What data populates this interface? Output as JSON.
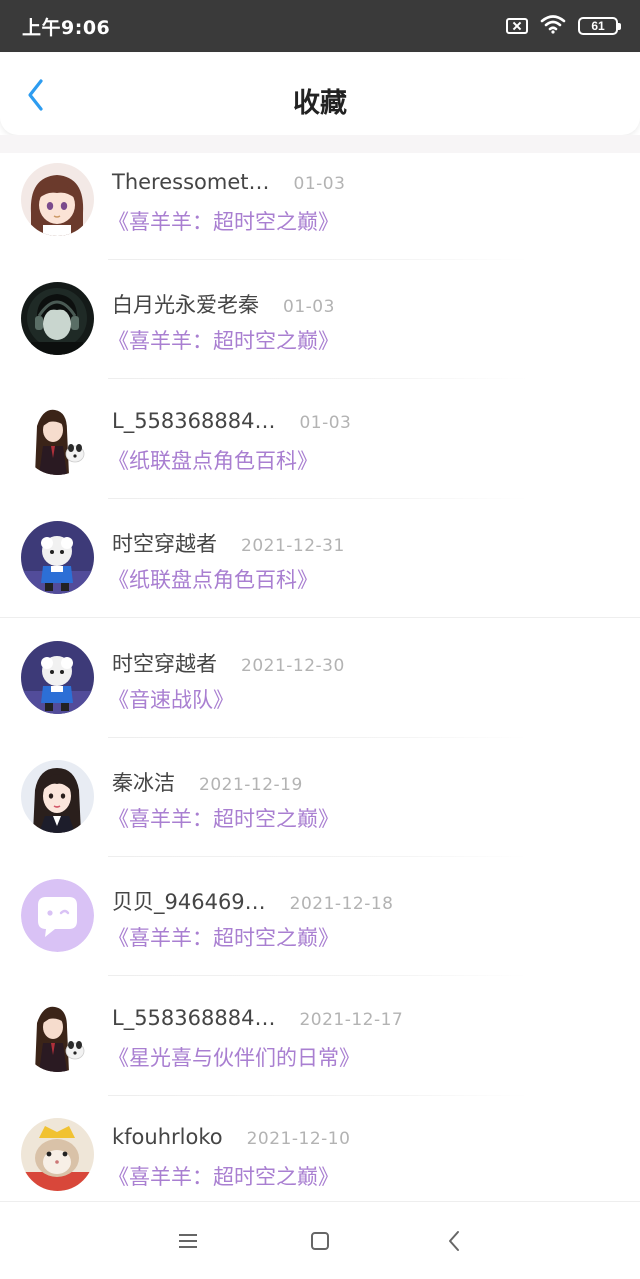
{
  "status_bar": {
    "time": "上午9:06",
    "battery": "61"
  },
  "header": {
    "title": "收藏"
  },
  "favorites": [
    {
      "name": "Theressomet…",
      "date": "01-03",
      "book": "《喜羊羊：超时空之巅》",
      "avatar": "anime-girl-avatar"
    },
    {
      "name": "白月光永爱老秦",
      "date": "01-03",
      "book": "《喜羊羊：超时空之巅》",
      "avatar": "headphones-boy-avatar"
    },
    {
      "name": "L_558368884…",
      "date": "01-03",
      "book": "《纸联盘点角色百科》",
      "avatar": "girl-with-dog-avatar"
    },
    {
      "name": "时空穿越者",
      "date": "2021-12-31",
      "book": "《纸联盘点角色百科》",
      "avatar": "sheep-character-avatar"
    },
    {
      "name": "时空穿越者",
      "date": "2021-12-30",
      "book": "《音速战队》",
      "avatar": "sheep-character-avatar"
    },
    {
      "name": "秦冰洁",
      "date": "2021-12-19",
      "book": "《喜羊羊：超时空之巅》",
      "avatar": "girl-portrait-avatar"
    },
    {
      "name": "贝贝_946469…",
      "date": "2021-12-18",
      "book": "《喜羊羊：超时空之巅》",
      "avatar": "default-chat-avatar"
    },
    {
      "name": "L_558368884…",
      "date": "2021-12-17",
      "book": "《星光喜与伙伴们的日常》",
      "avatar": "girl-with-dog-avatar"
    },
    {
      "name": "kfouhrloko",
      "date": "2021-12-10",
      "book": "《喜羊羊：超时空之巅》",
      "avatar": "hamster-avatar"
    }
  ],
  "colors": {
    "accent": "#2d9cf0",
    "book_title": "#a97fd1",
    "status_bar": "#3a3a3a",
    "default_avatar": "#d9c2f5"
  }
}
